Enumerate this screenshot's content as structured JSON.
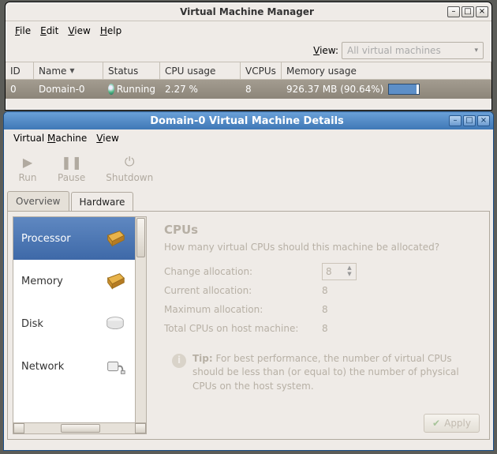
{
  "vmm": {
    "title": "Virtual Machine Manager",
    "menu": {
      "file": "File",
      "edit": "Edit",
      "view": "View",
      "help": "Help"
    },
    "viewLabel": "View:",
    "viewCombo": "All virtual machines",
    "columns": {
      "id": "ID",
      "name": "Name",
      "status": "Status",
      "cpu": "CPU usage",
      "vcpus": "VCPUs",
      "mem": "Memory usage"
    },
    "rows": [
      {
        "id": "0",
        "name": "Domain-0",
        "status": "Running",
        "cpu": "2.27 %",
        "vcpus": "8",
        "mem_text": "926.37 MB (90.64%)",
        "mem_pct": 90.64
      }
    ]
  },
  "details": {
    "title": "Domain-0 Virtual Machine Details",
    "menu": {
      "vm": "Virtual Machine",
      "view": "View"
    },
    "toolbar": {
      "run": "Run",
      "pause": "Pause",
      "shutdown": "Shutdown"
    },
    "tabs": {
      "overview": "Overview",
      "hardware": "Hardware"
    },
    "hwlist": {
      "processor": "Processor",
      "memory": "Memory",
      "disk": "Disk",
      "network": "Network"
    },
    "cpu": {
      "heading": "CPUs",
      "question": "How many virtual CPUs should this machine be allocated?",
      "change_label": "Change allocation:",
      "change_value": "8",
      "current_label": "Current allocation:",
      "current_value": "8",
      "max_label": "Maximum allocation:",
      "max_value": "8",
      "total_label": "Total CPUs on host machine:",
      "total_value": "8",
      "tip_bold": "Tip:",
      "tip_text": " For best performance, the number of virtual CPUs should be less than (or equal to) the number of physical CPUs on the host system.",
      "apply": "Apply"
    }
  }
}
